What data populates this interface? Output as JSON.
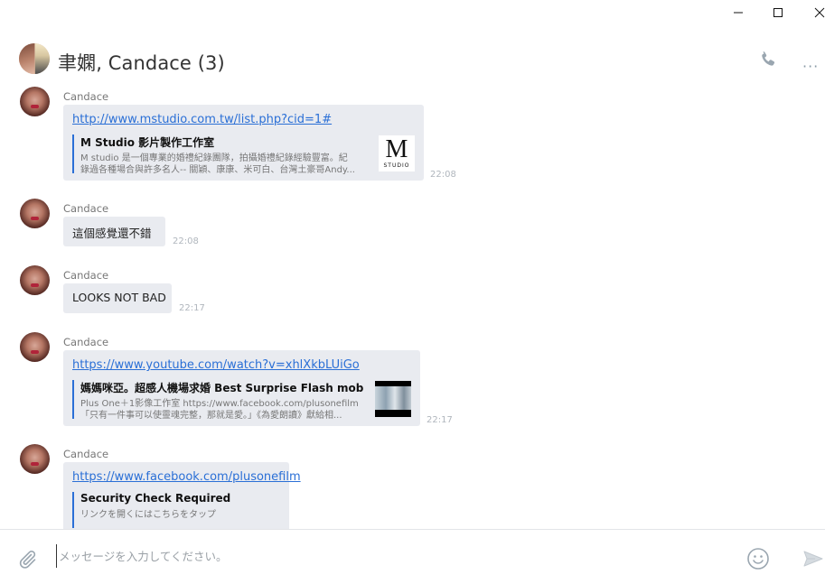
{
  "window": {
    "minimize_glyph": "—",
    "maximize_glyph": "☐",
    "close_glyph": "✕"
  },
  "header": {
    "title": "聿嫻, Candace (3)",
    "call_icon": "phone-icon",
    "more_glyph": "···",
    "more_icon": "more-icon"
  },
  "messages": [
    {
      "sender": "Candace",
      "type": "link",
      "url": "http://www.mstudio.com.tw/list.php?cid=1#",
      "preview_title": "M Studio 影片製作工作室",
      "preview_desc_1": "M studio 是一個專業的婚禮紀錄團隊，拍攝婚禮紀錄經驗豐富。紀",
      "preview_desc_2": "錄過各種場合與許多名人-- 關穎、康康、米可白、台灣土豪哥Andy...",
      "thumb_big": "M",
      "thumb_small": "STUDIO",
      "time": "22:08"
    },
    {
      "sender": "Candace",
      "type": "text",
      "text": "這個感覺還不錯",
      "time": "22:08"
    },
    {
      "sender": "Candace",
      "type": "text",
      "text": "LOOKS NOT BAD",
      "time": "22:17"
    },
    {
      "sender": "Candace",
      "type": "link",
      "url": "https://www.youtube.com/watch?v=xhlXkbLUiGo",
      "preview_title": "媽媽咪亞。超感人機場求婚 Best Surprise Flash mob Pro...",
      "preview_desc_1": "Plus One＋1影像工作室 https://www.facebook.com/plusonefilm",
      "preview_desc_2": "「只有一件事可以使靈魂完整，那就是愛。」《為愛朗讀》獻給相...",
      "time": "22:17"
    },
    {
      "sender": "Candace",
      "type": "link",
      "url": "https://www.facebook.com/plusonefilm",
      "preview_title": "Security Check Required",
      "preview_desc_1": "リンクを開くにはこちらをタップ"
    }
  ],
  "composer": {
    "placeholder": "メッセージを入力してください。",
    "attach_icon": "paperclip-icon",
    "emoji_icon": "emoji-icon",
    "send_icon": "send-icon"
  },
  "colors": {
    "link": "#2a6fd6",
    "bubble": "#e9ebf0",
    "icon_gray": "#9aa6b0"
  }
}
